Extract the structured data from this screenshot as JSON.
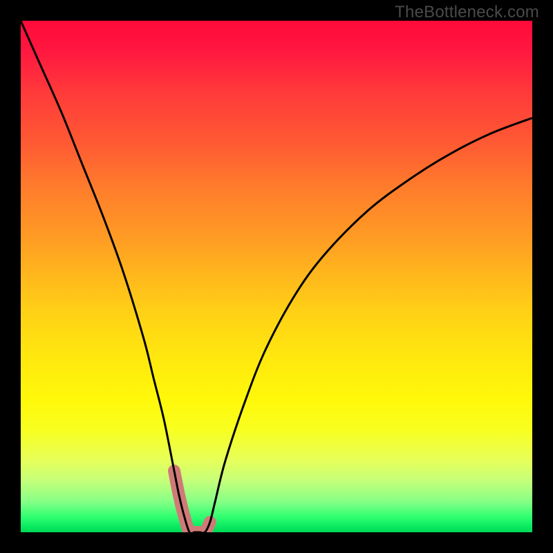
{
  "watermark": "TheBottleneck.com",
  "chart_data": {
    "type": "line",
    "title": "",
    "xlabel": "",
    "ylabel": "",
    "xlim": [
      0,
      100
    ],
    "ylim": [
      0,
      100
    ],
    "grid": false,
    "legend": false,
    "x": [
      0,
      4,
      8,
      12,
      16,
      20,
      24,
      26,
      28,
      30,
      31,
      32,
      33,
      34,
      35,
      36,
      37,
      38,
      40,
      44,
      48,
      54,
      60,
      68,
      76,
      84,
      92,
      100
    ],
    "values": [
      100,
      91,
      82,
      72,
      62,
      51,
      38,
      30,
      22,
      12,
      7,
      3,
      0,
      0,
      0,
      0,
      2,
      6,
      14,
      26,
      36,
      47,
      55,
      63,
      69,
      74,
      78,
      81
    ],
    "highlight": {
      "x_range": [
        30,
        36
      ],
      "color": "#d07a78",
      "stroke_width": 18
    },
    "background_gradient": {
      "direction": "vertical",
      "stops": [
        {
          "pos": 0.0,
          "color": "#ff0a3a"
        },
        {
          "pos": 0.3,
          "color": "#ff7a2c"
        },
        {
          "pos": 0.6,
          "color": "#ffe80e"
        },
        {
          "pos": 0.95,
          "color": "#30ff70"
        },
        {
          "pos": 1.0,
          "color": "#00d856"
        }
      ]
    }
  },
  "colors": {
    "curve": "#000000",
    "highlight": "#d07a78",
    "frame": "#000000"
  }
}
